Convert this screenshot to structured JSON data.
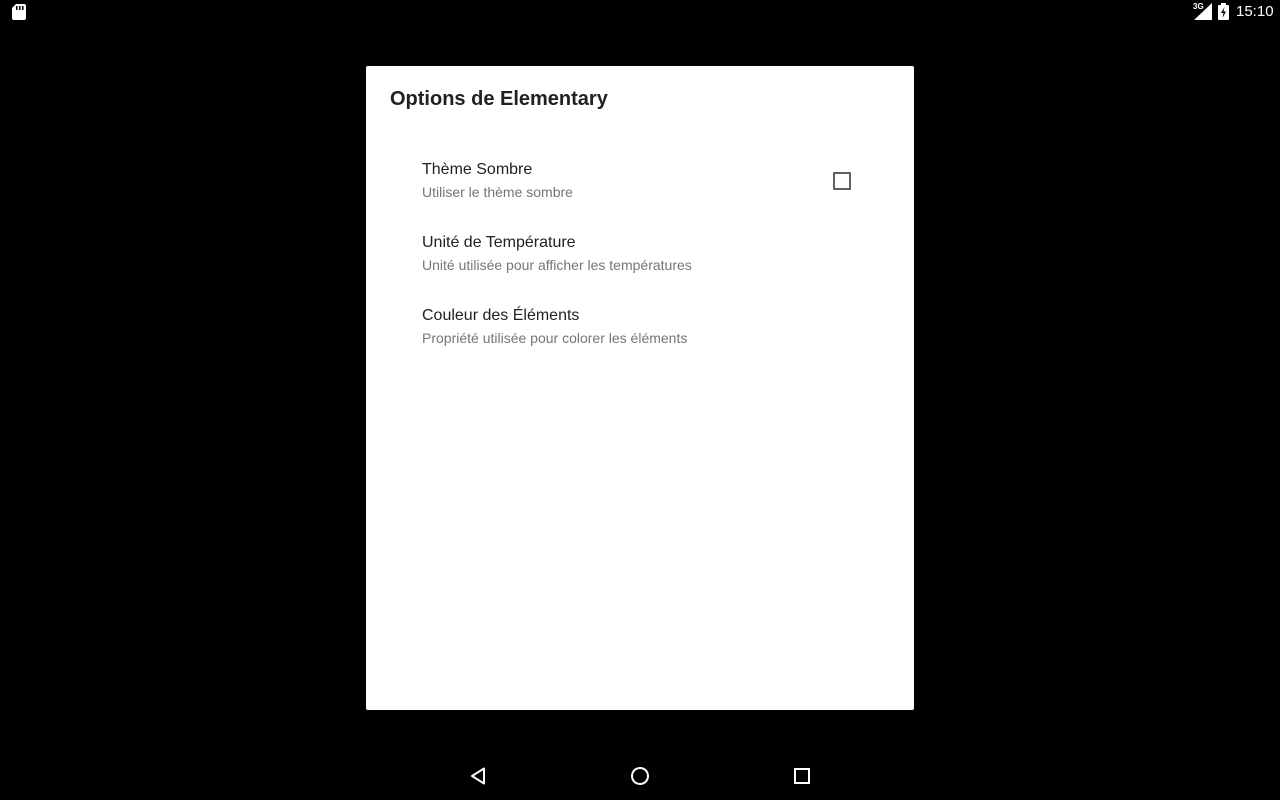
{
  "status_bar": {
    "network": "3G",
    "time": "15:10",
    "icons": [
      "sd-card-icon",
      "cell-signal-icon",
      "battery-charging-icon"
    ]
  },
  "dialog": {
    "title": "Options de Elementary",
    "preferences": [
      {
        "title": "Thème Sombre",
        "summary": "Utiliser le thème sombre",
        "checkbox_checked": false
      },
      {
        "title": "Unité de Température",
        "summary": "Unité utilisée pour afficher les températures"
      },
      {
        "title": "Couleur des Éléments",
        "summary": "Propriété utilisée pour colorer les éléments"
      }
    ]
  },
  "navigation_bar": {
    "buttons": [
      "back-icon",
      "home-icon",
      "recents-icon"
    ]
  },
  "colors": {
    "background": "#000000",
    "dialog": "#ffffff",
    "title_text": "#212121",
    "summary_text": "#757575"
  }
}
